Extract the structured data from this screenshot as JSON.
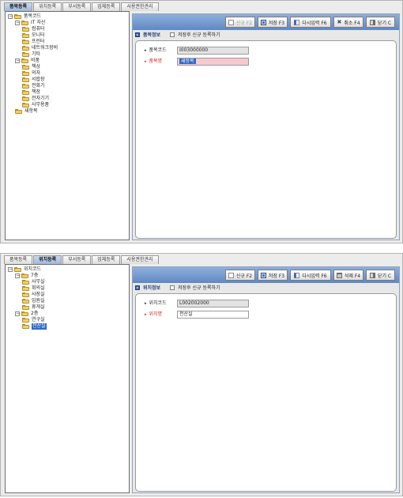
{
  "panel1": {
    "tabs": [
      "품목등록",
      "위치등록",
      "부서등록",
      "업체등록",
      "사용권한관리"
    ],
    "active_tab": "품목등록",
    "tree": [
      {
        "label": "품목코드",
        "level": 0,
        "toggle": "⊟",
        "selected": false
      },
      {
        "label": "IT 자산",
        "level": 1,
        "toggle": "⊟",
        "selected": false
      },
      {
        "label": "컴퓨터",
        "level": 2,
        "toggle": "",
        "selected": false
      },
      {
        "label": "모니터",
        "level": 2,
        "toggle": "",
        "selected": false
      },
      {
        "label": "프린터",
        "level": 2,
        "toggle": "",
        "selected": false
      },
      {
        "label": "네트워크장비",
        "level": 2,
        "toggle": "",
        "selected": false
      },
      {
        "label": "기타",
        "level": 2,
        "toggle": "",
        "selected": false
      },
      {
        "label": "비품",
        "level": 1,
        "toggle": "⊟",
        "selected": false
      },
      {
        "label": "책상",
        "level": 2,
        "toggle": "",
        "selected": false
      },
      {
        "label": "의자",
        "level": 2,
        "toggle": "",
        "selected": false
      },
      {
        "label": "서랍장",
        "level": 2,
        "toggle": "",
        "selected": false
      },
      {
        "label": "전화기",
        "level": 2,
        "toggle": "",
        "selected": false
      },
      {
        "label": "책장",
        "level": 2,
        "toggle": "",
        "selected": false
      },
      {
        "label": "전자기기",
        "level": 2,
        "toggle": "",
        "selected": false
      },
      {
        "label": "사무용품",
        "level": 2,
        "toggle": "",
        "selected": false
      },
      {
        "label": "새항목",
        "level": 1,
        "toggle": "",
        "selected": false
      }
    ],
    "toolbar": {
      "new_label": "신규 F2",
      "save_label": "저장 F3",
      "reinput_label": "다시입력 F6",
      "cancel_label": "취소 F4",
      "close_label": "닫기 C"
    },
    "section_title": "품목정보",
    "checkbox_label": "저장후 신규 등록하기",
    "fields": {
      "code_label": "품목코드",
      "code_value": "I003000000",
      "name_label": "품목명",
      "name_value": "새항목"
    }
  },
  "panel2": {
    "tabs": [
      "품목등록",
      "위치등록",
      "부서등록",
      "업체등록",
      "사용권한관리"
    ],
    "active_tab": "위치등록",
    "tree": [
      {
        "label": "위치코드",
        "level": 0,
        "toggle": "⊟",
        "selected": false
      },
      {
        "label": "7층",
        "level": 1,
        "toggle": "⊟",
        "selected": false
      },
      {
        "label": "사무실",
        "level": 2,
        "toggle": "",
        "selected": false
      },
      {
        "label": "회의실",
        "level": 2,
        "toggle": "",
        "selected": false
      },
      {
        "label": "사장실",
        "level": 2,
        "toggle": "",
        "selected": false
      },
      {
        "label": "임원실",
        "level": 2,
        "toggle": "",
        "selected": false
      },
      {
        "label": "휴게실",
        "level": 2,
        "toggle": "",
        "selected": false
      },
      {
        "label": "2층",
        "level": 1,
        "toggle": "⊟",
        "selected": false
      },
      {
        "label": "연구실",
        "level": 2,
        "toggle": "",
        "selected": false
      },
      {
        "label": "전산실",
        "level": 2,
        "toggle": "",
        "selected": true
      }
    ],
    "toolbar": {
      "new_label": "신규 F2",
      "save_label": "저장 F3",
      "reinput_label": "다시입력 F6",
      "delete_label": "삭제 F4",
      "close_label": "닫기 C"
    },
    "section_title": "위치정보",
    "checkbox_label": "저장후 신규 등록하기",
    "fields": {
      "code_label": "위치코드",
      "code_value": "L002002000",
      "name_label": "위치명",
      "name_value": "전산실"
    }
  }
}
